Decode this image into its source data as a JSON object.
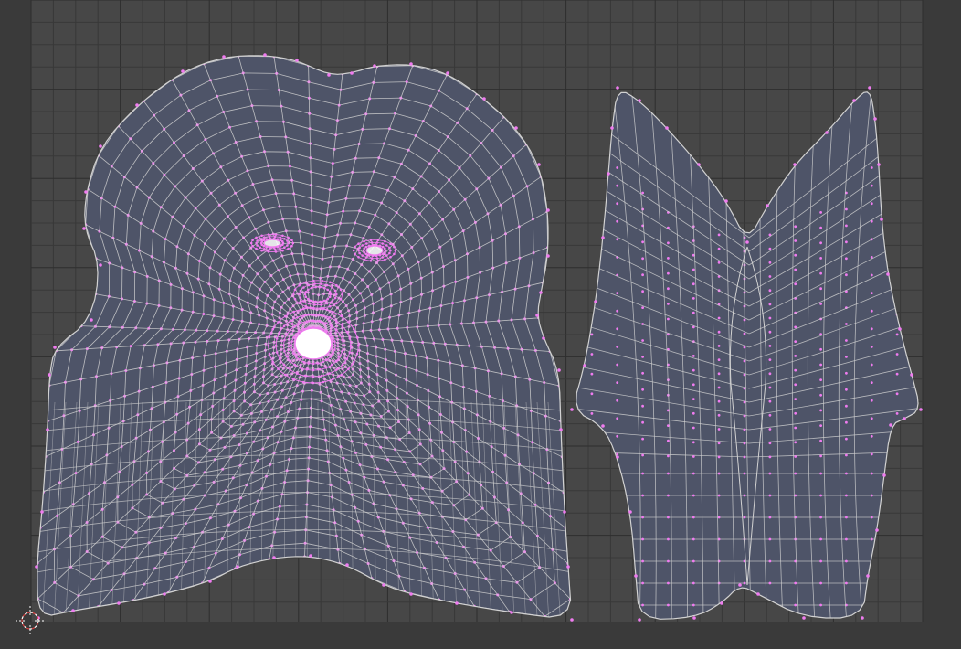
{
  "editor": {
    "type": "UV/Image Editor",
    "mode": "UV edit",
    "background_color": "#3a3a3a",
    "grid_area_color": "#474747",
    "grid_line_color": "#383838",
    "grid_major_line_color": "#2e2e2e",
    "border_color": "#2e2e2e"
  },
  "uv_islands": [
    {
      "name": "face-island",
      "fill_color": "#4e5468",
      "edge_color": "#d2d2d2",
      "vertex_color": "#f07cf0",
      "dense_features": [
        "left-eye",
        "right-eye",
        "nose",
        "mouth"
      ]
    },
    {
      "name": "back-island",
      "fill_color": "#4e5468",
      "edge_color": "#d2d2d2",
      "vertex_color": "#f07cf0"
    }
  ],
  "cursor": {
    "name": "2d-cursor",
    "color_primary": "#ffffff",
    "color_secondary": "#d94040"
  }
}
